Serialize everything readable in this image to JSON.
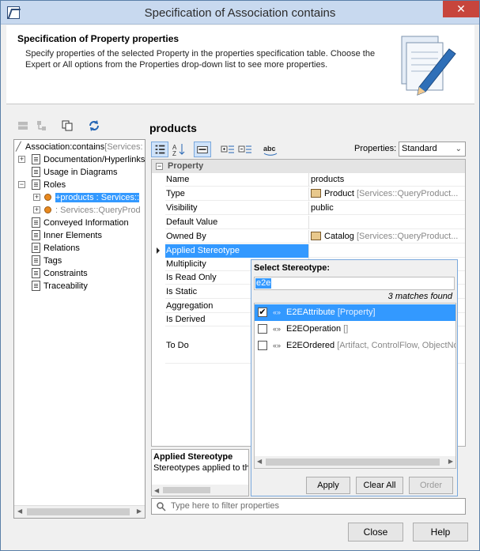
{
  "window": {
    "title": "Specification of Association contains",
    "close_glyph": "✕"
  },
  "header": {
    "title": "Specification of Property properties",
    "description": "Specify properties of the selected Property in the properties specification table. Choose the Expert or All options from the Properties drop-down list to see more properties."
  },
  "tree": {
    "root": "Association:contains",
    "root_suffix": "[Services:",
    "items": [
      {
        "label": "Documentation/Hyperlinks"
      },
      {
        "label": "Usage in Diagrams"
      },
      {
        "label": "Roles"
      },
      {
        "label": "+products : Services::"
      },
      {
        "label": ": Services::QueryProd"
      },
      {
        "label": "Conveyed Information"
      },
      {
        "label": "Inner Elements"
      },
      {
        "label": "Relations"
      },
      {
        "label": "Tags"
      },
      {
        "label": "Constraints"
      },
      {
        "label": "Traceability"
      }
    ]
  },
  "panel": {
    "title": "products"
  },
  "toolbar": {
    "properties_label": "Properties:",
    "properties_value": "Standard",
    "abc_label": "abc"
  },
  "table": {
    "group": "Property",
    "rows": [
      {
        "name": "Name",
        "value": "products",
        "meta": ""
      },
      {
        "name": "Type",
        "value": "Product",
        "meta": "[Services::QueryProduct..."
      },
      {
        "name": "Visibility",
        "value": "public",
        "meta": ""
      },
      {
        "name": "Default Value",
        "value": "",
        "meta": ""
      },
      {
        "name": "Owned By",
        "value": "Catalog",
        "meta": "[Services::QueryProduct..."
      },
      {
        "name": "Applied Stereotype",
        "value": "",
        "meta": ""
      },
      {
        "name": "Multiplicity",
        "value": "",
        "meta": ""
      },
      {
        "name": "Is Read Only",
        "value": "",
        "meta": ""
      },
      {
        "name": "Is Static",
        "value": "",
        "meta": ""
      },
      {
        "name": "Aggregation",
        "value": "",
        "meta": ""
      },
      {
        "name": "Is Derived",
        "value": "",
        "meta": ""
      },
      {
        "name": "To Do",
        "value": "",
        "meta": ""
      }
    ]
  },
  "description": {
    "title": "Applied Stereotype",
    "text": "Stereotypes applied to thi"
  },
  "filter": {
    "placeholder": "Type here to filter properties"
  },
  "popup": {
    "title": "Select Stereotype:",
    "search_value": "e2e",
    "matches": "3 matches found",
    "items": [
      {
        "name": "E2EAttribute",
        "meta": "[Property]",
        "checked": true
      },
      {
        "name": "E2EOperation",
        "meta": "[]",
        "checked": false
      },
      {
        "name": "E2EOrdered",
        "meta": "[Artifact, ControlFlow, ObjectNo",
        "checked": false
      }
    ],
    "buttons": {
      "apply": "Apply",
      "clear": "Clear All",
      "order": "Order"
    }
  },
  "buttons": {
    "close": "Close",
    "help": "Help"
  },
  "colors": {
    "selection": "#3399ff",
    "title_bar": "#c8d9ef",
    "close_red": "#c7453c"
  }
}
